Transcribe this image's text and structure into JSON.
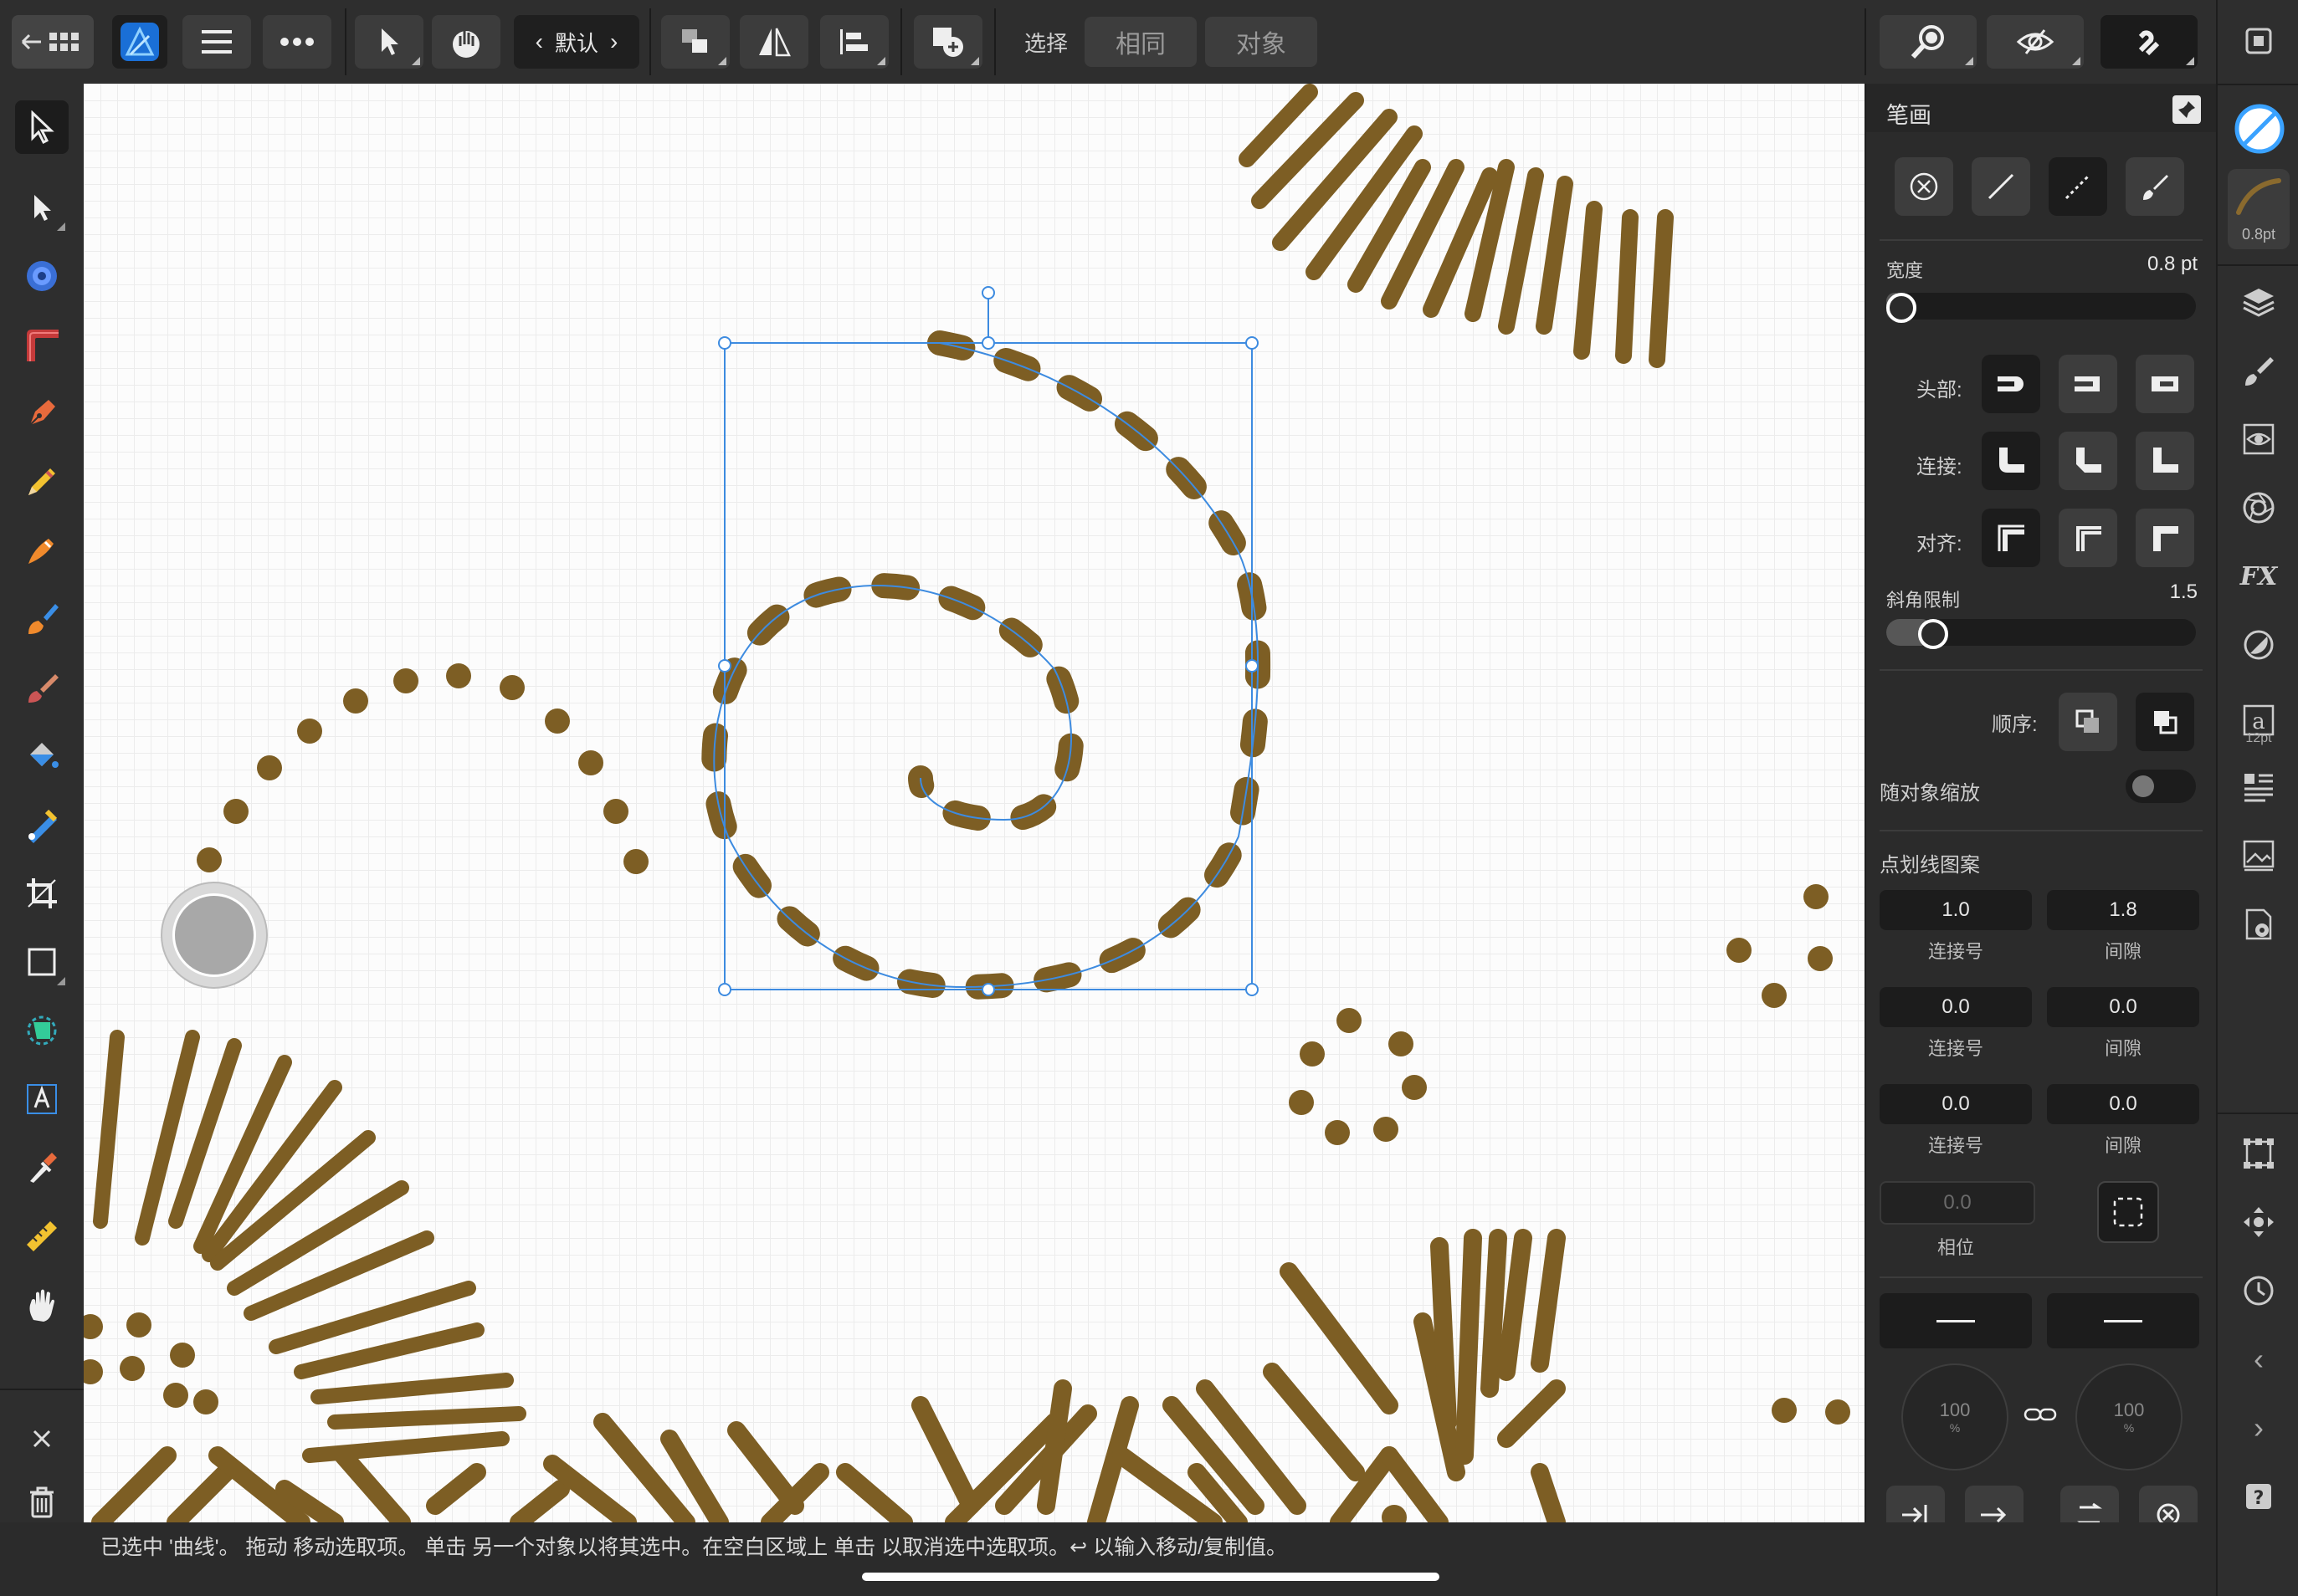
{
  "topbar": {
    "preset_label": "默认",
    "select_label": "选择",
    "same_button": "相同",
    "object_button": "对象"
  },
  "panel": {
    "title": "笔画",
    "width_label": "宽度",
    "width_value": "0.8 pt",
    "width_fraction": 0.02,
    "cap_label": "头部:",
    "join_label": "连接:",
    "align_label": "对齐:",
    "miter_label": "斜角限制",
    "miter_value": "1.5",
    "miter_fraction": 0.1,
    "order_label": "顺序:",
    "scale_with_object_label": "随对象缩放",
    "scale_with_object_on": false,
    "dash_pattern_label": "点划线图案",
    "dash_rows": [
      {
        "dash": "1.0",
        "gap": "1.8"
      },
      {
        "dash": "0.0",
        "gap": "0.0"
      },
      {
        "dash": "0.0",
        "gap": "0.0"
      }
    ],
    "dash_label": "连接号",
    "gap_label": "间隙",
    "phase_value": "0.0",
    "phase_label": "相位",
    "arrow_start": "100",
    "arrow_end": "100",
    "percent": "%"
  },
  "studio": {
    "stroke_size": "0.8pt",
    "text_size": "12pt"
  },
  "status": {
    "text": "已选中 '曲线'。 拖动 移动选取项。 单击 另一个对象以将其选中。在空白区域上 单击 以取消选中选取项。↩ 以输入移动/复制值。"
  },
  "colors": {
    "stroke_brown": "#8a6a2e",
    "selection_blue": "#3d8be0",
    "accent_blue": "#3aa2ff"
  }
}
